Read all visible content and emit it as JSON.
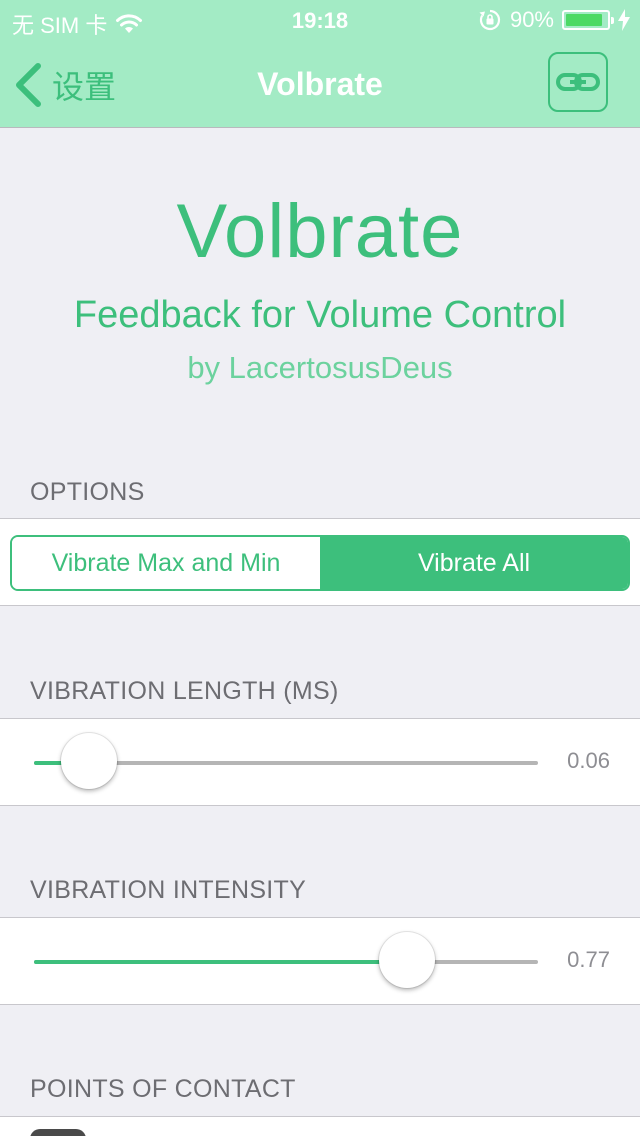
{
  "status_bar": {
    "carrier": "无 SIM 卡",
    "time": "19:18",
    "battery_percent": "90%",
    "battery_level": 0.9
  },
  "nav": {
    "back_label": "设置",
    "title": "Volbrate"
  },
  "header": {
    "app_name": "Volbrate",
    "tagline": "Feedback for Volume Control",
    "author": "by LacertosusDeus"
  },
  "options": {
    "label": "OPTIONS",
    "segments": [
      "Vibrate Max and Min",
      "Vibrate All"
    ],
    "selected_index": 1
  },
  "vibration_length": {
    "label": "VIBRATION LENGTH (MS)",
    "value": 0.06,
    "display": "0.06"
  },
  "vibration_intensity": {
    "label": "VIBRATION INTENSITY",
    "value": 0.77,
    "display": "0.77"
  },
  "points_of_contact": {
    "label": "POINTS OF CONTACT"
  },
  "colors": {
    "accent": "#3dbf7c",
    "nav_background": "#a3ebc5",
    "page_background": "#efeff4"
  }
}
